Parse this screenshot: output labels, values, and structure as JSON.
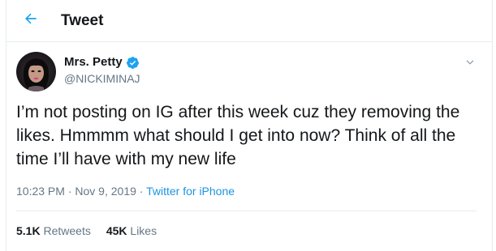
{
  "header": {
    "title": "Tweet",
    "back_icon": "arrow-left-icon",
    "accent_color": "#1da1f2"
  },
  "user": {
    "display_name": "Mrs. Petty",
    "handle": "@NICKIMINAJ",
    "verified": true,
    "verified_icon": "verified-badge-icon"
  },
  "tweet": {
    "text": "I’m not posting on IG after this week cuz they removing the likes. Hmmmm what should I get into now? Think of all the time I’ll have with my new life",
    "time": "10:23 PM",
    "separator": " · ",
    "date": "Nov 9, 2019",
    "source": "Twitter for iPhone"
  },
  "stats": {
    "retweets_count": "5.1K",
    "retweets_label": "Retweets",
    "likes_count": "45K",
    "likes_label": "Likes"
  },
  "colors": {
    "text_primary": "#14171a",
    "text_secondary": "#657786",
    "link": "#1b95e0",
    "border": "#e6ecf0"
  }
}
